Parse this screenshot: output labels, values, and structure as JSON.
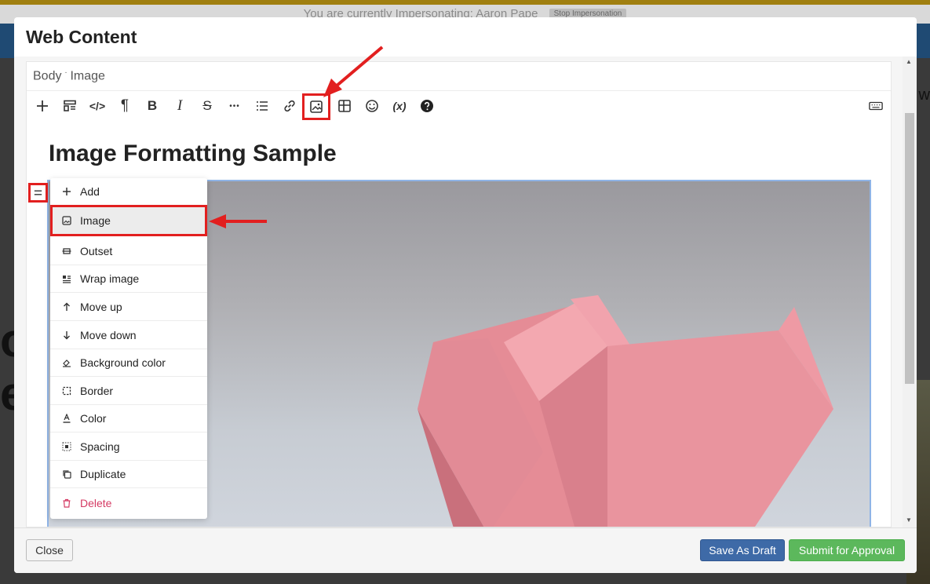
{
  "background": {
    "impersonation_text": "You are currently Impersonating: Aaron Pape",
    "stop_label": "Stop Impersonation",
    "big_text": "o\ne",
    "right_text": "e w"
  },
  "modal": {
    "title": "Web Content",
    "breadcrumb": [
      "Body",
      "Image"
    ],
    "content_title": "Image Formatting Sample"
  },
  "toolbar": {
    "buttons": [
      "plus-icon",
      "template-icon",
      "code-icon",
      "paragraph-icon",
      "bold-icon",
      "italic-icon",
      "strikethrough-icon",
      "more-icon",
      "list-icon",
      "link-icon",
      "image-icon",
      "table-icon",
      "emoji-icon",
      "variable-icon",
      "help-icon",
      "keyboard-icon"
    ],
    "bold": "B",
    "italic": "I",
    "strike": "S",
    "paragraph": "¶",
    "code": "</>",
    "more": "•••",
    "variable": "(x)"
  },
  "block_menu": {
    "items": [
      {
        "label": "Add",
        "icon": "plus-icon"
      },
      {
        "label": "Image",
        "icon": "image-icon"
      },
      {
        "label": "Outset",
        "icon": "outset-icon"
      },
      {
        "label": "Wrap image",
        "icon": "wrap-image-icon"
      },
      {
        "label": "Move up",
        "icon": "arrow-up-icon"
      },
      {
        "label": "Move down",
        "icon": "arrow-down-icon"
      },
      {
        "label": "Background color",
        "icon": "paint-bucket-icon"
      },
      {
        "label": "Border",
        "icon": "border-icon"
      },
      {
        "label": "Color",
        "icon": "text-color-icon"
      },
      {
        "label": "Spacing",
        "icon": "spacing-icon"
      },
      {
        "label": "Duplicate",
        "icon": "duplicate-icon"
      },
      {
        "label": "Delete",
        "icon": "trash-icon"
      }
    ]
  },
  "footer": {
    "close_label": "Close",
    "draft_label": "Save As Draft",
    "submit_label": "Submit for Approval"
  },
  "colors": {
    "annotation_red": "#e21f1f",
    "draft_blue": "#3e6aa7",
    "submit_green": "#5cb85c",
    "delete_pink": "#d43a63",
    "image_border": "#8fb4e6"
  }
}
